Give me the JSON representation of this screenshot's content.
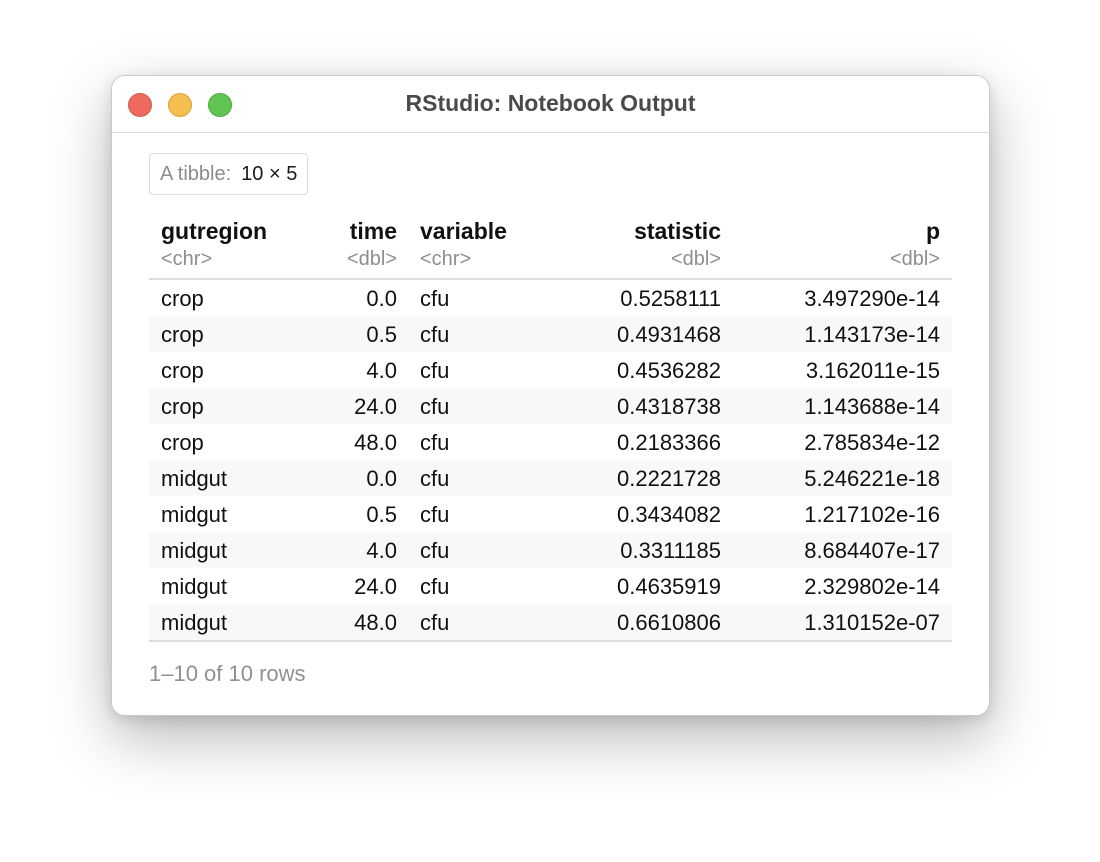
{
  "window": {
    "title": "RStudio: Notebook Output"
  },
  "tibble": {
    "label": "A tibble:",
    "dims": "10 × 5"
  },
  "columns": [
    {
      "name": "gutregion",
      "type": "<chr>"
    },
    {
      "name": "time",
      "type": "<dbl>"
    },
    {
      "name": "variable",
      "type": "<chr>"
    },
    {
      "name": "statistic",
      "type": "<dbl>"
    },
    {
      "name": "p",
      "type": "<dbl>"
    }
  ],
  "rows": [
    [
      "crop",
      "0.0",
      "cfu",
      "0.5258111",
      "3.497290e-14"
    ],
    [
      "crop",
      "0.5",
      "cfu",
      "0.4931468",
      "1.143173e-14"
    ],
    [
      "crop",
      "4.0",
      "cfu",
      "0.4536282",
      "3.162011e-15"
    ],
    [
      "crop",
      "24.0",
      "cfu",
      "0.4318738",
      "1.143688e-14"
    ],
    [
      "crop",
      "48.0",
      "cfu",
      "0.2183366",
      "2.785834e-12"
    ],
    [
      "midgut",
      "0.0",
      "cfu",
      "0.2221728",
      "5.246221e-18"
    ],
    [
      "midgut",
      "0.5",
      "cfu",
      "0.3434082",
      "1.217102e-16"
    ],
    [
      "midgut",
      "4.0",
      "cfu",
      "0.3311185",
      "8.684407e-17"
    ],
    [
      "midgut",
      "24.0",
      "cfu",
      "0.4635919",
      "2.329802e-14"
    ],
    [
      "midgut",
      "48.0",
      "cfu",
      "0.6610806",
      "1.310152e-07"
    ]
  ],
  "footer": {
    "rows_text": "1–10 of 10 rows"
  }
}
